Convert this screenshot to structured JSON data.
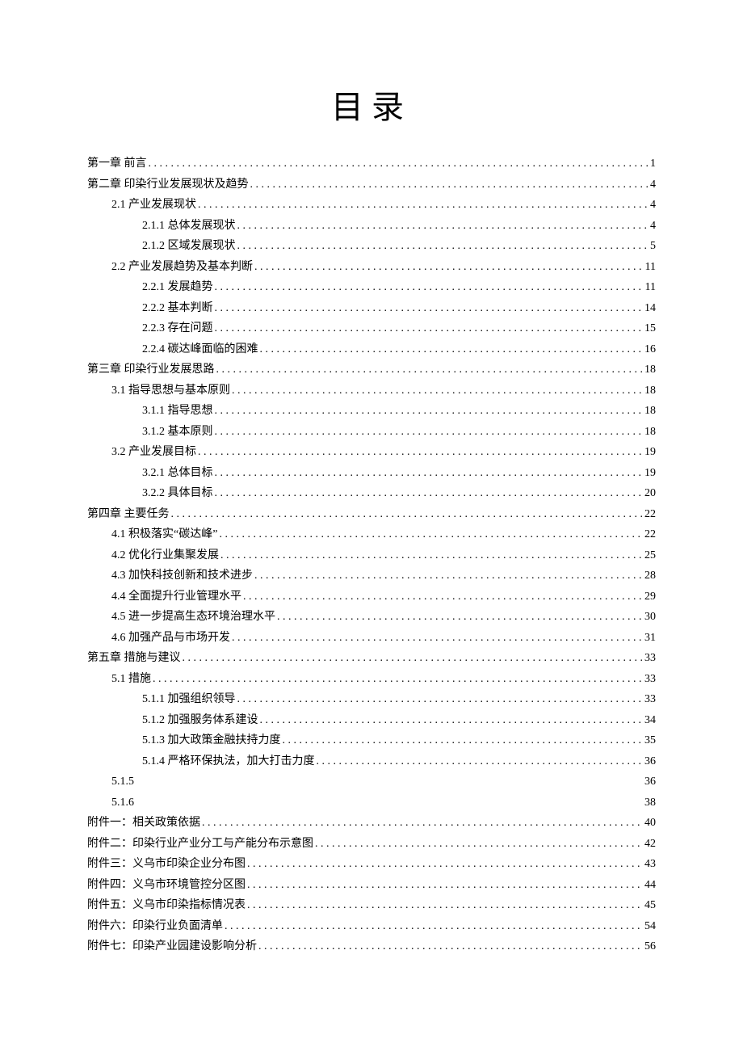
{
  "title": "目录",
  "toc": [
    {
      "label": "第一章 前言",
      "page": "1",
      "level": 0
    },
    {
      "label": "第二章 印染行业发展现状及趋势",
      "page": "4",
      "level": 0
    },
    {
      "label": "2.1  产业发展现状",
      "page": "4",
      "level": 1
    },
    {
      "label": "2.1.1  总体发展现状",
      "page": "4",
      "level": 2
    },
    {
      "label": "2.1.2  区域发展现状",
      "page": "5",
      "level": 2
    },
    {
      "label": "2.2  产业发展趋势及基本判断",
      "page": "11",
      "level": 1
    },
    {
      "label": "2.2.1  发展趋势",
      "page": "11",
      "level": 2
    },
    {
      "label": "2.2.2  基本判断",
      "page": "14",
      "level": 2
    },
    {
      "label": "2.2.3  存在问题",
      "page": "15",
      "level": 2
    },
    {
      "label": "2.2.4  碳达峰面临的困难",
      "page": "16",
      "level": 2
    },
    {
      "label": "第三章 印染行业发展思路",
      "page": "18",
      "level": 0
    },
    {
      "label": "3.1  指导思想与基本原则",
      "page": "18",
      "level": 1
    },
    {
      "label": "3.1.1  指导思想",
      "page": "18",
      "level": 2
    },
    {
      "label": "3.1.2  基本原则",
      "page": "18",
      "level": 2
    },
    {
      "label": "3.2  产业发展目标",
      "page": "19",
      "level": 1
    },
    {
      "label": "3.2.1  总体目标",
      "page": "19",
      "level": 2
    },
    {
      "label": "3.2.2  具体目标",
      "page": "20",
      "level": 2
    },
    {
      "label": "第四章 主要任务",
      "page": "22",
      "level": 0
    },
    {
      "label": "4.1  积极落实“碳达峰”",
      "page": "22",
      "level": 1
    },
    {
      "label": "4.2  优化行业集聚发展",
      "page": "25",
      "level": 1
    },
    {
      "label": "4.3  加快科技创新和技术进步",
      "page": "28",
      "level": 1
    },
    {
      "label": "4.4  全面提升行业管理水平",
      "page": "29",
      "level": 1
    },
    {
      "label": "4.5  进一步提高生态环境治理水平",
      "page": "30",
      "level": 1
    },
    {
      "label": "4.6  加强产品与市场开发",
      "page": "31",
      "level": 1
    },
    {
      "label": "第五章 措施与建议",
      "page": "33",
      "level": 0
    },
    {
      "label": "5.1  措施",
      "page": "33",
      "level": 1
    },
    {
      "label": "5.1.1  加强组织领导",
      "page": "33",
      "level": 2
    },
    {
      "label": "5.1.2  加强服务体系建设",
      "page": "34",
      "level": 2
    },
    {
      "label": "5.1.3  加大政策金融扶持力度",
      "page": "35",
      "level": 2
    },
    {
      "label": "5.1.4  严格环保执法，加大打击力度",
      "page": "36",
      "level": 2
    },
    {
      "label": "5.1.5",
      "page": "36",
      "level": "x",
      "noleader": true
    },
    {
      "label": "5.1.6",
      "page": "38",
      "level": "x",
      "noleader": true
    },
    {
      "label": "附件一：相关政策依据",
      "page": "40",
      "level": 0
    },
    {
      "label": "附件二：印染行业产业分工与产能分布示意图",
      "page": "42",
      "level": 0
    },
    {
      "label": "附件三：义乌市印染企业分布图",
      "page": "43",
      "level": 0
    },
    {
      "label": "附件四：义乌市环境管控分区图",
      "page": "44",
      "level": 0
    },
    {
      "label": "附件五：义乌市印染指标情况表",
      "page": "45",
      "level": 0
    },
    {
      "label": "附件六：印染行业负面清单",
      "page": "54",
      "level": 0
    },
    {
      "label": "附件七：印染产业园建设影响分析",
      "page": "56",
      "level": 0
    }
  ]
}
